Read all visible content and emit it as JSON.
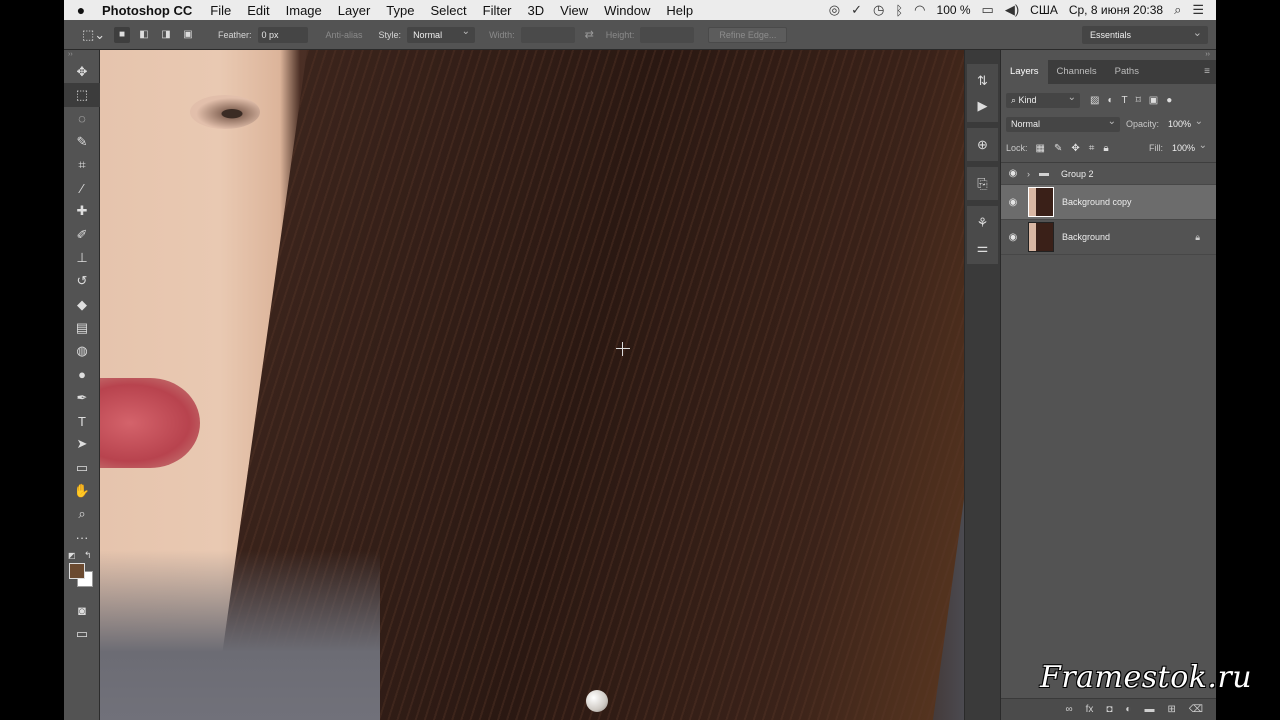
{
  "menubar": {
    "apple": "",
    "app_name": "Photoshop CC",
    "menus": [
      "File",
      "Edit",
      "Image",
      "Layer",
      "Type",
      "Select",
      "Filter",
      "3D",
      "View",
      "Window",
      "Help"
    ],
    "battery": "100 %",
    "locale": "США",
    "datetime": "Ср, 8 июня  20:38"
  },
  "options": {
    "feather_label": "Feather:",
    "feather_value": "0 px",
    "anti_alias": "Anti-alias",
    "style_label": "Style:",
    "style_value": "Normal",
    "width_label": "Width:",
    "height_label": "Height:",
    "refine_edge": "Refine Edge...",
    "workspace": "Essentials"
  },
  "layers_panel": {
    "tabs": [
      "Layers",
      "Channels",
      "Paths"
    ],
    "filter_kind": "Kind",
    "blend_mode": "Normal",
    "opacity_label": "Opacity:",
    "opacity_value": "100%",
    "lock_label": "Lock:",
    "fill_label": "Fill:",
    "fill_value": "100%",
    "layers": [
      {
        "name": "Group 2"
      },
      {
        "name": "Background copy"
      },
      {
        "name": "Background"
      }
    ]
  },
  "watermark": "Framestok.ru"
}
